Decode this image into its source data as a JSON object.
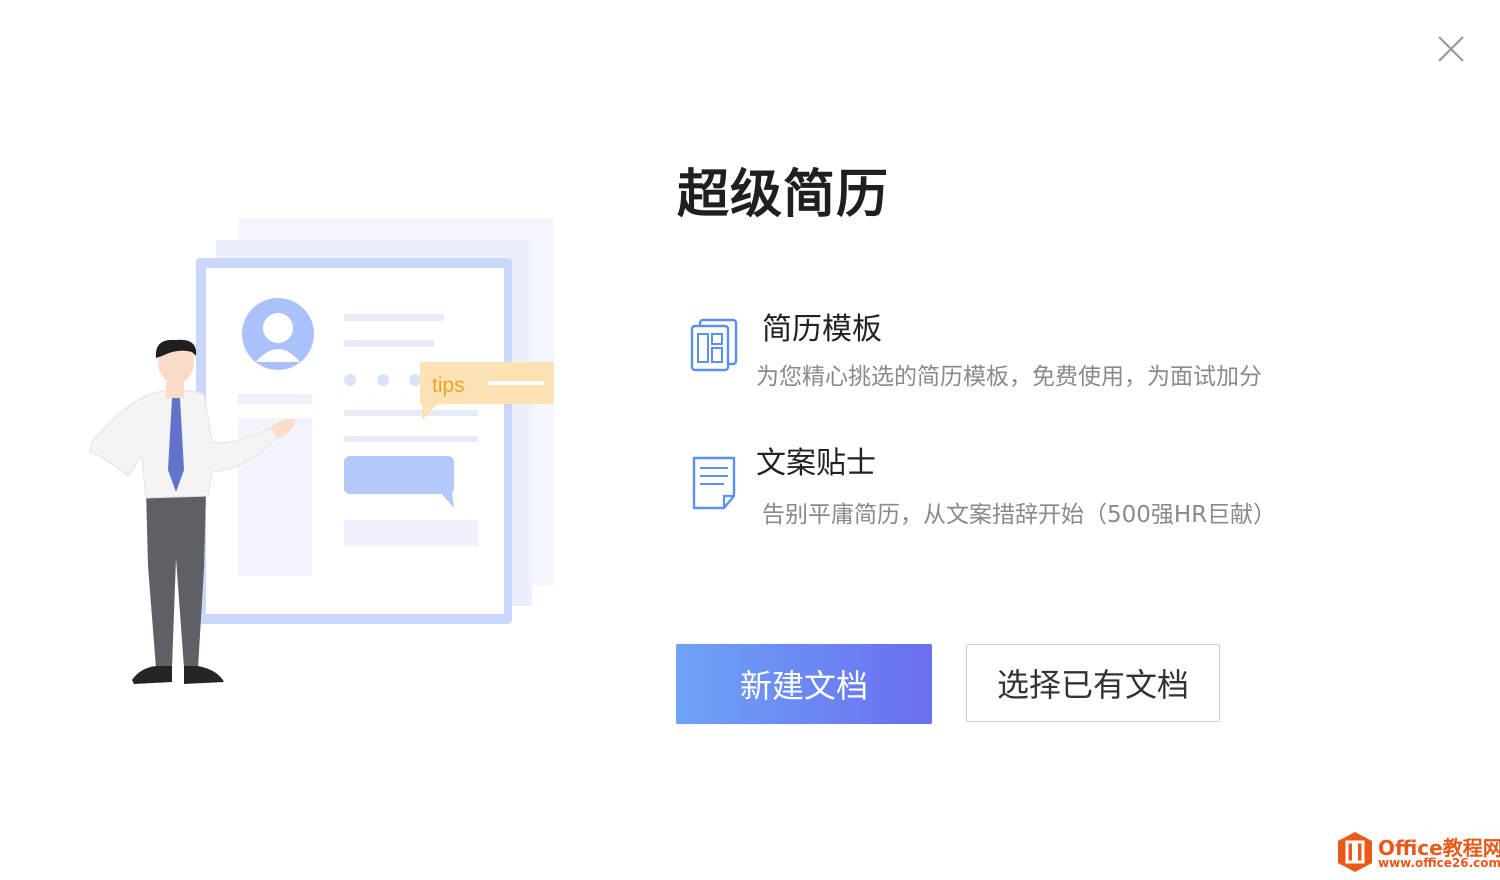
{
  "dialog": {
    "title": "超级简历",
    "close_icon": "close-icon"
  },
  "illustration": {
    "tips_label": "tips",
    "colors": {
      "card_border": "#c9d7fb",
      "avatar": "#aac1fb",
      "tips_bubble": "#fde3b4",
      "tips_text": "#f0a12a",
      "tie": "#6373c9"
    }
  },
  "features": [
    {
      "icon": "template-icon",
      "name": "简历模板",
      "description": "为您精心挑选的简历模板，免费使用，为面试加分"
    },
    {
      "icon": "document-icon",
      "name": "文案贴士",
      "description": "告别平庸简历，从文案措辞开始（500强HR巨献）"
    }
  ],
  "actions": {
    "new_document": "新建文档",
    "open_existing": "选择已有文档"
  },
  "watermark": {
    "name": "Office教程网",
    "url": "www.office26.com"
  },
  "colors": {
    "primary_start": "#6ea4f6",
    "primary_end": "#6a6ef0",
    "icon_blue": "#5b8ff0"
  }
}
